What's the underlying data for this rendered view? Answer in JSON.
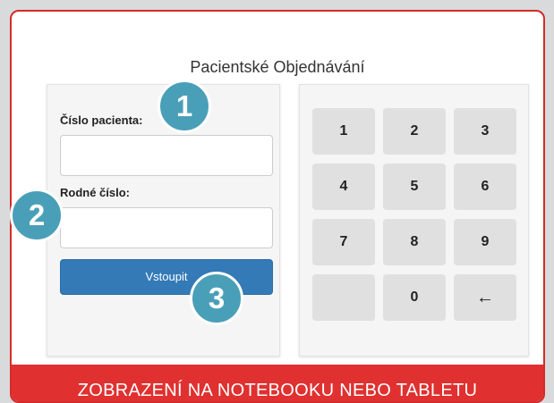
{
  "page_title": "Pacientské Objednávání",
  "login_form": {
    "patient_number_label": "Číslo pacienta:",
    "patient_number_value": "",
    "birth_number_label": "Rodné číslo:",
    "birth_number_value": "",
    "submit_label": "Vstoupit"
  },
  "keypad": {
    "keys": [
      "1",
      "2",
      "3",
      "4",
      "5",
      "6",
      "7",
      "8",
      "9",
      "",
      "0",
      "←"
    ]
  },
  "callouts": [
    "1",
    "2",
    "3"
  ],
  "banner": "ZOBRAZENÍ NA NOTEBOOKU NEBO TABLETU",
  "colors": {
    "accent_red": "#e03030",
    "button_blue": "#337ab7",
    "callout_teal": "#4a9fb8"
  }
}
